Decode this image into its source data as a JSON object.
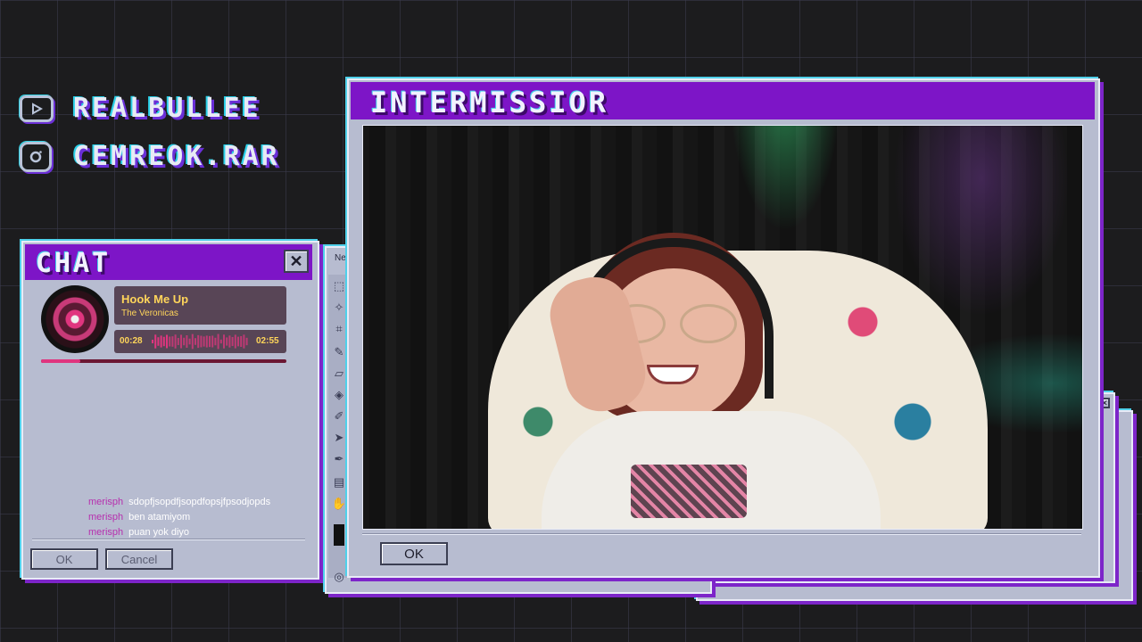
{
  "social": {
    "youtube_handle": "REALBULLEE",
    "instagram_handle": "CEMREOK.RAR"
  },
  "chat_window": {
    "title": "CHAT",
    "close_glyph": "✕",
    "now_playing": {
      "song": "Hook Me Up",
      "artist": "The Veronicas",
      "elapsed": "00:28",
      "duration": "02:55",
      "progress": 0.16
    },
    "messages": [
      {
        "user": "merisph",
        "text": "sdopfjsopdfjsopdfopsjfpsodjopds"
      },
      {
        "user": "merisph",
        "text": "ben atamiyom"
      },
      {
        "user": "merisph",
        "text": "puan yok diyo"
      }
    ],
    "ok_label": "OK",
    "cancel_label": "Cancel"
  },
  "paint_window": {
    "title_fragment": "Ne"
  },
  "main_window": {
    "title": "INTERMISSIOR",
    "ok_label": "OK"
  },
  "colors": {
    "titlebar": "#7d15c7",
    "window_body": "#b7bcd0",
    "song_text": "#ffd55a",
    "waveform": "#e0357f",
    "chat_username": "#b72fae"
  }
}
